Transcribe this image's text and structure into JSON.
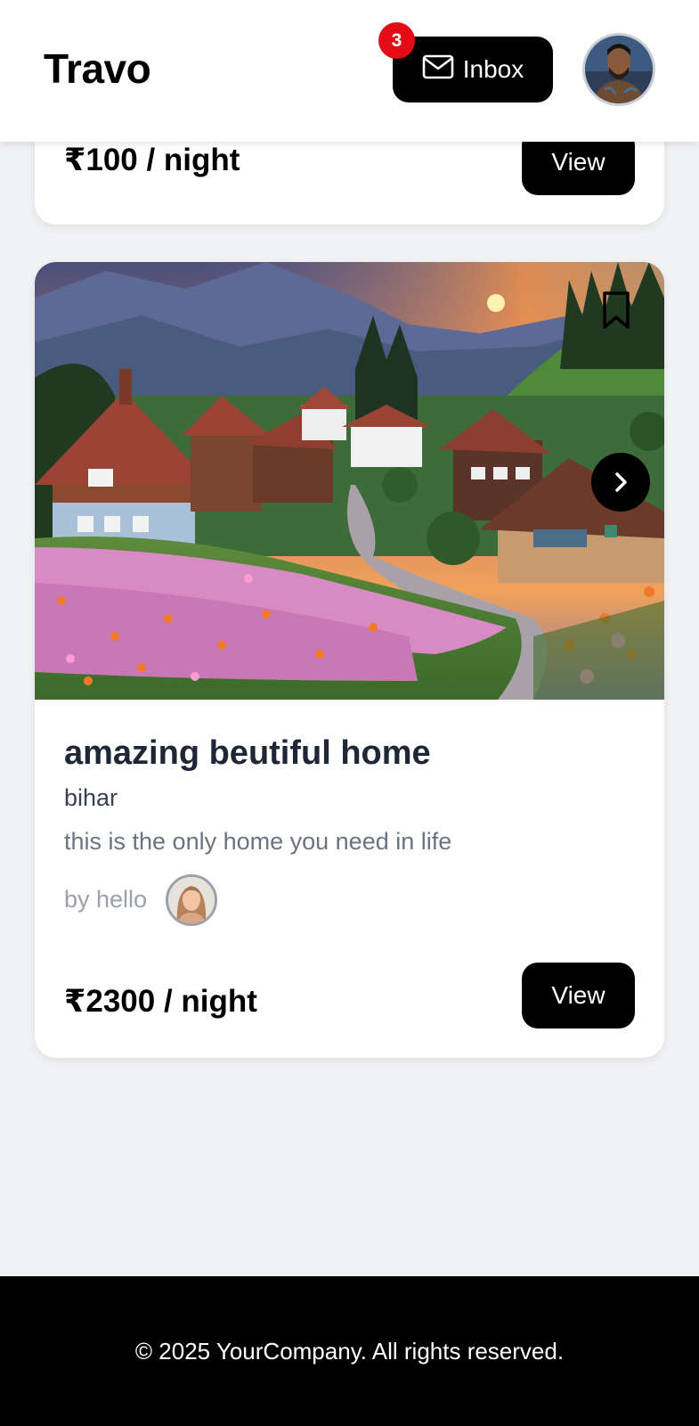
{
  "header": {
    "brand": "Travo",
    "inbox_label": "Inbox",
    "inbox_count": "3"
  },
  "listings": [
    {
      "price": "₹100 / night",
      "view_label": "View"
    },
    {
      "title": "amazing beutiful home",
      "location": "bihar",
      "description": "this is the only home you need in life",
      "host_label": "by hello",
      "price": "₹2300 / night",
      "view_label": "View"
    }
  ],
  "footer": {
    "copyright": "© 2025 YourCompany. All rights reserved."
  },
  "colors": {
    "primary": "#000000",
    "badge": "#e30b14",
    "background": "#f1f2f4",
    "title": "#1f2736"
  },
  "icons": {
    "inbox": "mail-icon",
    "bookmark": "bookmark-icon",
    "next": "chevron-right-icon"
  }
}
